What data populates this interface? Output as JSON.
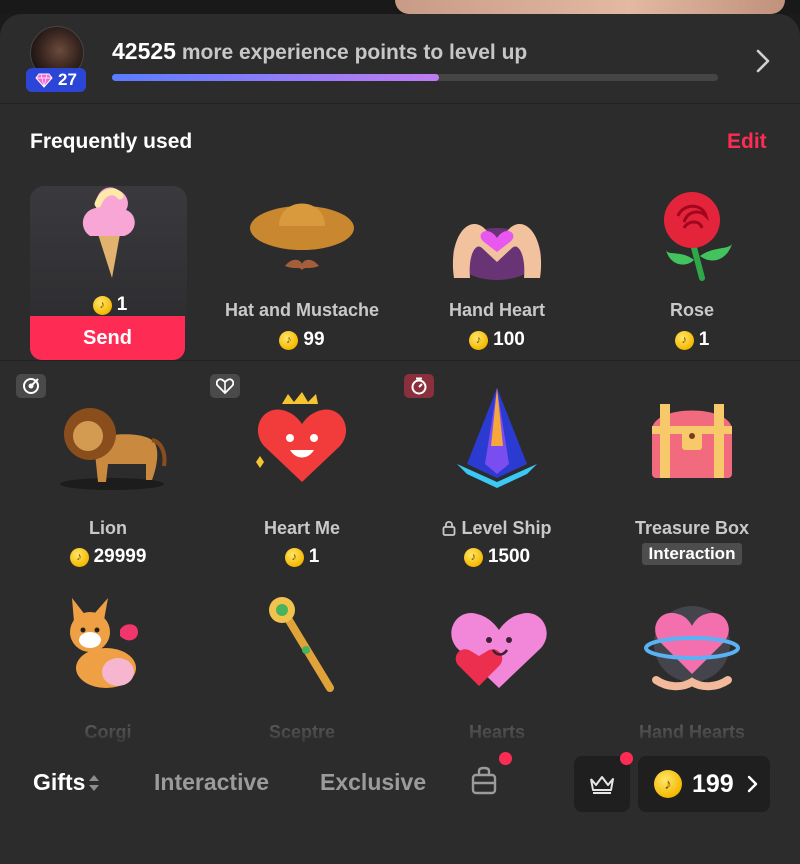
{
  "level": {
    "badge_level": "27",
    "xp_points": "42525",
    "xp_message": "more experience points to level up",
    "progress": 0.54
  },
  "section": {
    "title": "Frequently used",
    "edit_label": "Edit"
  },
  "frequent": [
    {
      "name": "",
      "price": "1",
      "icon": "ice-cream",
      "selected": true
    },
    {
      "name": "Hat and Mustache",
      "price": "99",
      "icon": "cowboy-hat"
    },
    {
      "name": "Hand Heart",
      "price": "100",
      "icon": "hand-heart"
    },
    {
      "name": "Rose",
      "price": "1",
      "icon": "rose"
    }
  ],
  "send_label": "Send",
  "gifts": [
    {
      "name": "Lion",
      "price": "29999",
      "icon": "lion",
      "tag": "target-icon"
    },
    {
      "name": "Heart Me",
      "price": "1",
      "icon": "heart-face",
      "tag": "heart-outline-icon"
    },
    {
      "name": "Level Ship",
      "price": "1500",
      "icon": "ship",
      "tag": "timer-icon",
      "locked": true
    },
    {
      "name": "Treasure Box",
      "label": "Interaction",
      "icon": "treasure-chest"
    },
    {
      "name": "Corgi",
      "icon": "corgi"
    },
    {
      "name": "Sceptre",
      "icon": "sceptre"
    },
    {
      "name": "Hearts",
      "icon": "hearts"
    },
    {
      "name": "Hand Hearts",
      "icon": "hand-hearts"
    }
  ],
  "tabs": {
    "gifts": "Gifts",
    "interactive": "Interactive",
    "exclusive": "Exclusive"
  },
  "balance": "199",
  "colors": {
    "accent": "#fe2c55",
    "badge": "#2b46d6",
    "coin": "#f5b900",
    "panel": "#2c2c2c"
  }
}
